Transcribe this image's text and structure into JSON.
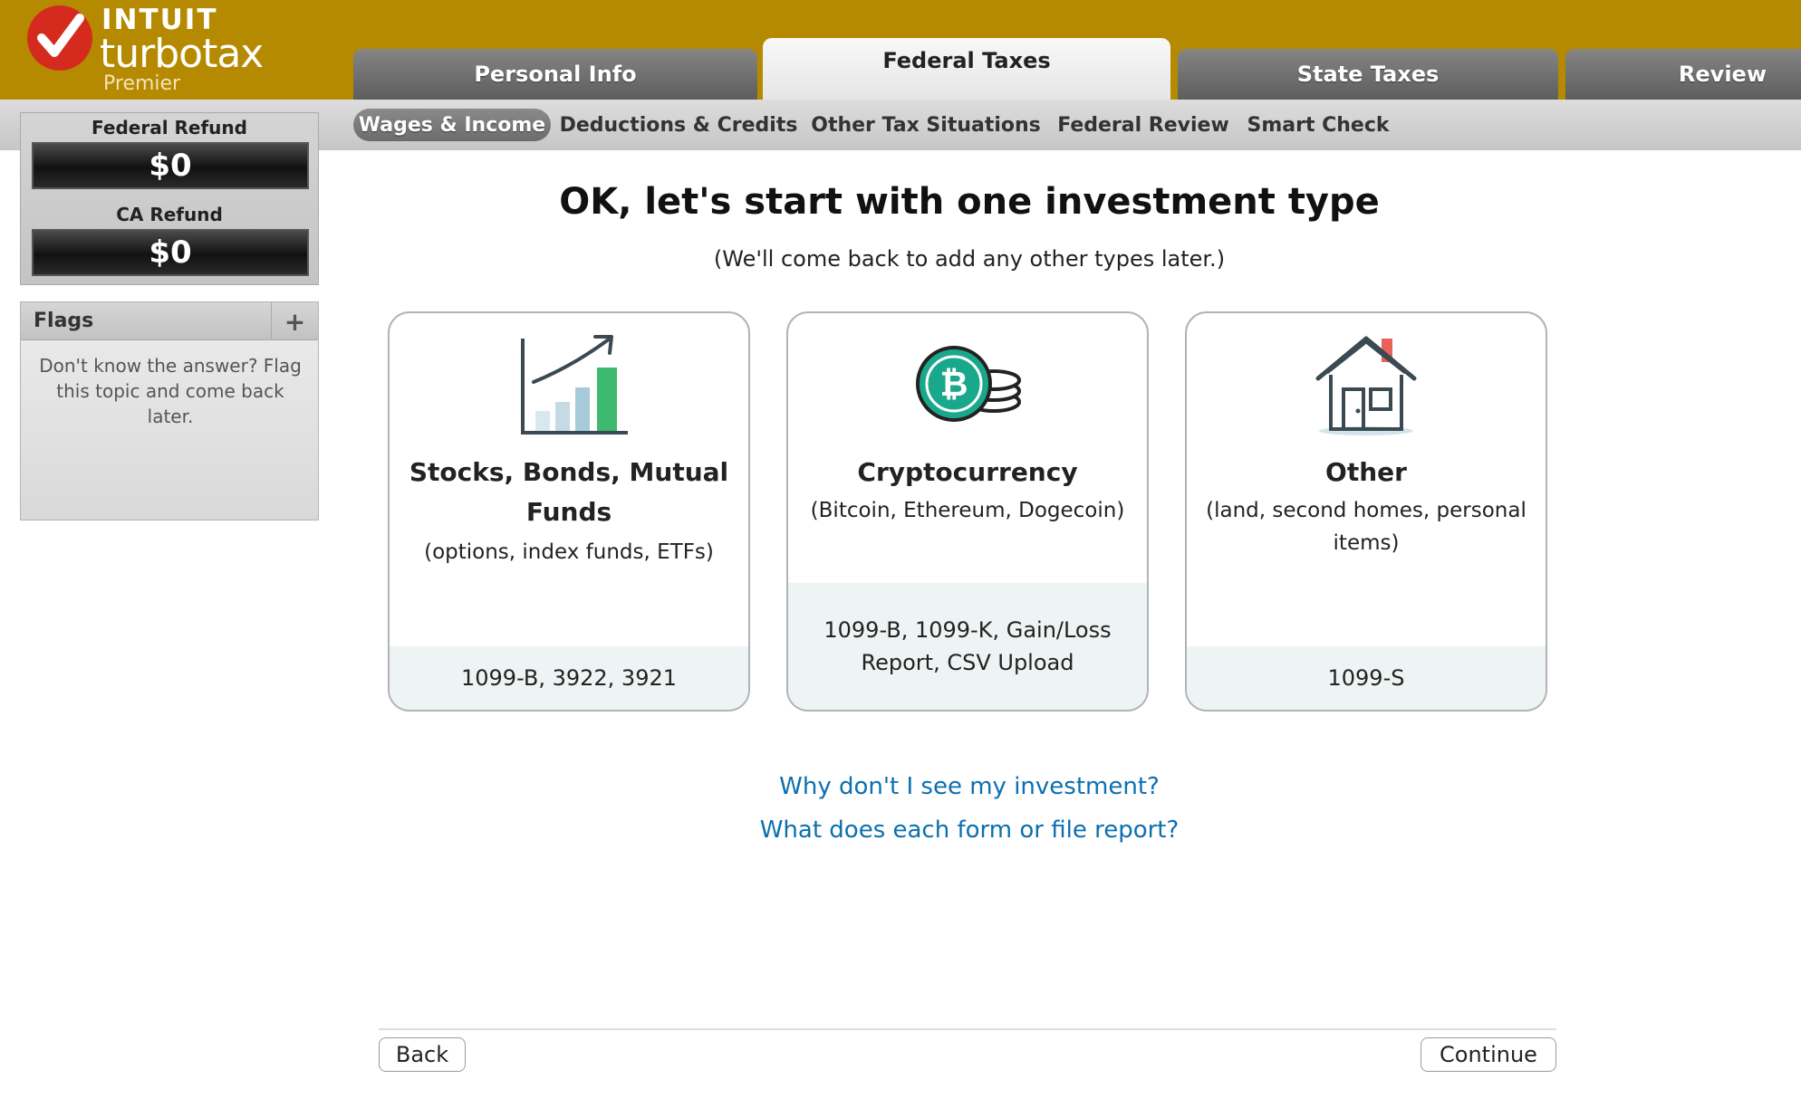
{
  "brand": {
    "company": "INTUIT",
    "product": "turbotax",
    "edition": "Premier"
  },
  "main_tabs": [
    {
      "label": "Personal Info",
      "active": false
    },
    {
      "label": "Federal Taxes",
      "active": true
    },
    {
      "label": "State Taxes",
      "active": false
    },
    {
      "label": "Review",
      "active": false
    }
  ],
  "sub_tabs": [
    {
      "label": "Wages & Income",
      "active": true
    },
    {
      "label": "Deductions & Credits",
      "active": false
    },
    {
      "label": "Other Tax Situations",
      "active": false
    },
    {
      "label": "Federal Review",
      "active": false
    },
    {
      "label": "Smart Check",
      "active": false
    }
  ],
  "refunds": {
    "federal_label": "Federal Refund",
    "federal_value": "$0",
    "state_label": "CA Refund",
    "state_value": "$0"
  },
  "flags": {
    "title": "Flags",
    "add_symbol": "+",
    "help_text": "Don't know the answer? Flag this topic and come back later."
  },
  "page": {
    "heading": "OK, let's start with one investment type",
    "subheading": "(We'll come back to add any other types later.)"
  },
  "cards": [
    {
      "icon": "stock-chart-icon",
      "title": "Stocks, Bonds, Mutual Funds",
      "description": "(options, index funds, ETFs)",
      "forms": "1099-B, 3922, 3921"
    },
    {
      "icon": "bitcoin-coins-icon",
      "title": "Cryptocurrency",
      "description": "(Bitcoin, Ethereum, Dogecoin)",
      "forms": "1099-B, 1099-K, Gain/Loss Report, CSV Upload"
    },
    {
      "icon": "house-icon",
      "title": "Other",
      "description": "(land, second homes, personal items)",
      "forms": "1099-S"
    }
  ],
  "links": {
    "why_not_see": "Why don't I see my investment?",
    "what_each_form": "What does each form or file report?"
  },
  "buttons": {
    "back": "Back",
    "continue": "Continue"
  },
  "colors": {
    "banner": "#b58a00",
    "link": "#0b6fb0",
    "chart_green": "#3dba6f",
    "crypto_teal": "#1aa88c",
    "house_chimney": "#e8645a"
  }
}
